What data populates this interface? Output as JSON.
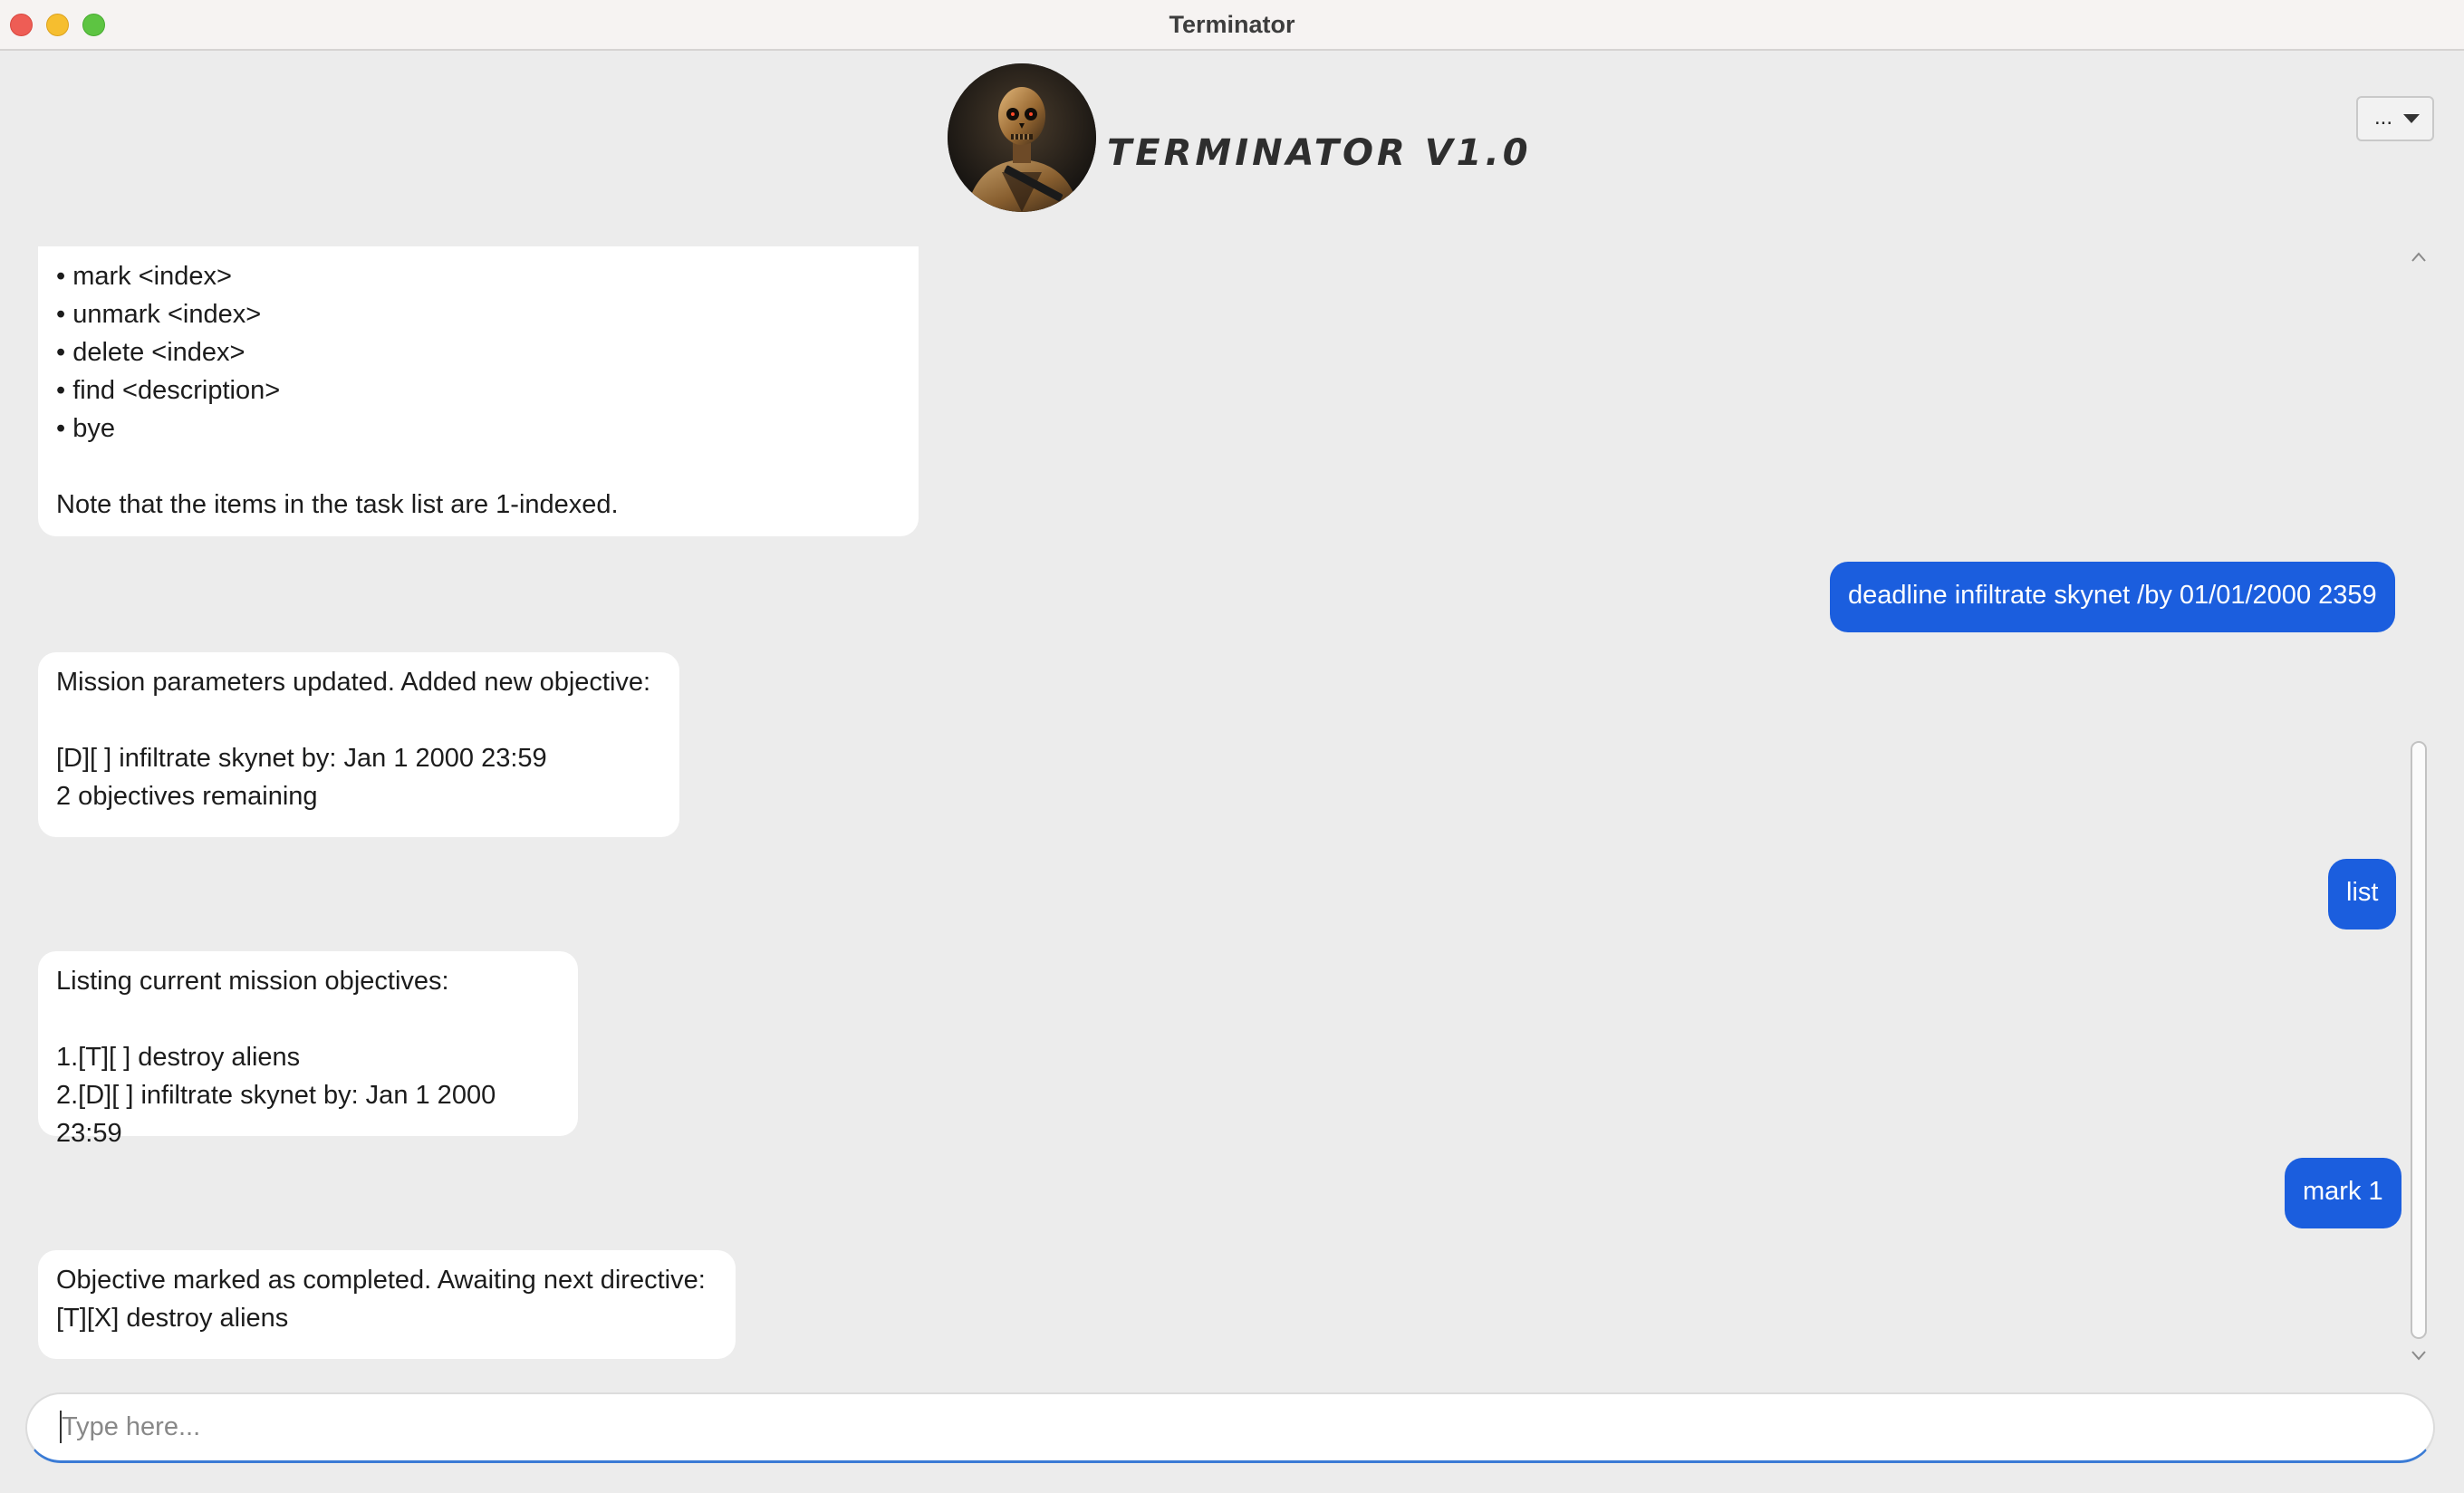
{
  "window": {
    "title": "Terminator"
  },
  "header": {
    "app_title": "TERMINATOR V1.0",
    "menu_label": "..."
  },
  "messages": [
    {
      "sender": "bot",
      "text": "• mark <index>\n• unmark <index>\n• delete <index>\n• find <description>\n• bye\n\nNote that the items in the task list are 1-indexed."
    },
    {
      "sender": "user",
      "text": "deadline infiltrate skynet /by 01/01/2000 2359"
    },
    {
      "sender": "bot",
      "text": "Mission parameters updated. Added new objective:\n\n[D][ ] infiltrate skynet by: Jan 1 2000 23:59\n2 objectives remaining"
    },
    {
      "sender": "user",
      "text": "list"
    },
    {
      "sender": "bot",
      "text": "Listing current mission objectives:\n\n1.[T][ ] destroy aliens\n2.[D][ ] infiltrate skynet by: Jan 1 2000 23:59"
    },
    {
      "sender": "user",
      "text": "mark 1"
    },
    {
      "sender": "bot",
      "text": "Objective marked as completed. Awaiting next directive:\n[T][X] destroy aliens"
    }
  ],
  "input": {
    "placeholder": "Type here...",
    "value": ""
  },
  "icons": {
    "close": "close-window-icon",
    "minimize": "minimize-window-icon",
    "maximize": "maximize-window-icon",
    "avatar": "terminator-avatar-icon",
    "menu_caret": "chevron-down-icon",
    "scroll_up": "scroll-up-arrow-icon",
    "scroll_down": "scroll-down-arrow-icon"
  },
  "colors": {
    "user_bubble": "#1b5ede",
    "bot_bubble": "#ffffff",
    "background": "#ececec",
    "close": "#ee5d55",
    "minimize": "#f6be2f",
    "maximize": "#5dc442"
  },
  "scroll": {
    "position_fraction": 1.0,
    "visible_fraction": 0.59
  }
}
